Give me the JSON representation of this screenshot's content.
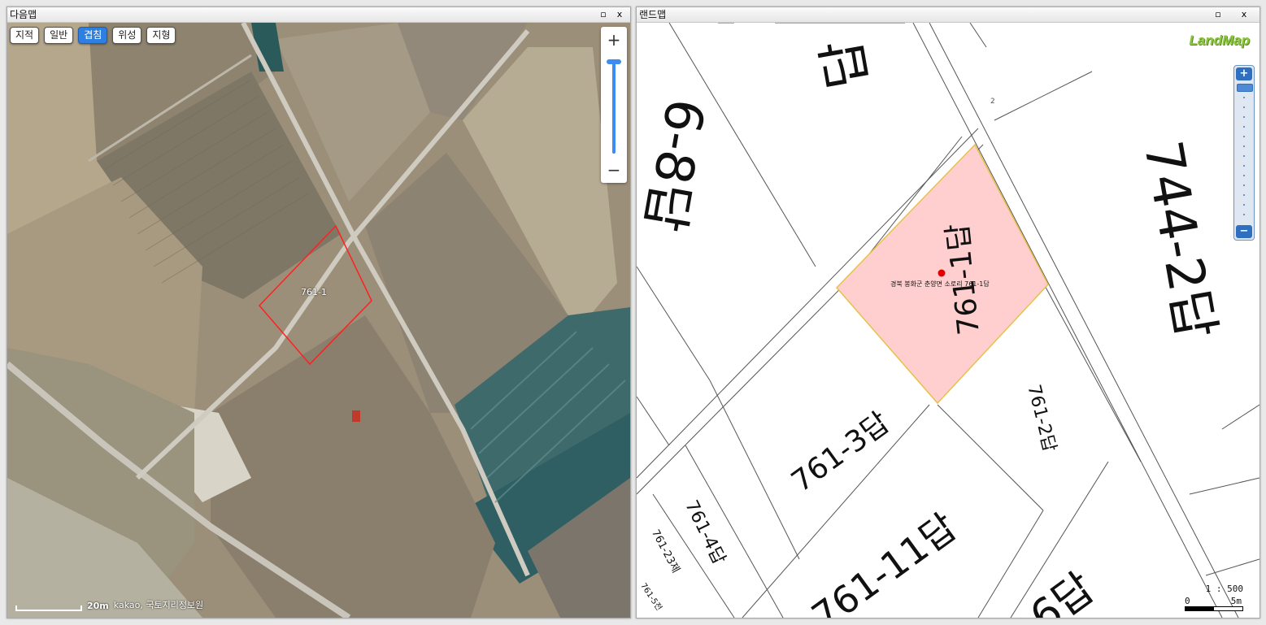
{
  "left_window": {
    "title": "다음맵",
    "minimize_label": "▫",
    "close_label": "x",
    "tabs": [
      {
        "label": "지적",
        "active": false
      },
      {
        "label": "일반",
        "active": false
      },
      {
        "label": "겹침",
        "active": true
      },
      {
        "label": "위성",
        "active": false
      },
      {
        "label": "지형",
        "active": false
      }
    ],
    "zoom_in_label": "+",
    "zoom_out_label": "−",
    "parcel_label": "761-1",
    "scale_text": "20m",
    "attribution": "kakao, 국토지리정보원"
  },
  "right_window": {
    "title": "랜드맵",
    "minimize_label": "▫",
    "close_label": "x",
    "logo": "LandMap",
    "zoom_in_label": "+",
    "zoom_out_label": "−",
    "selected_parcel_address": "경북 봉화군 춘양면 소로리 761-1답",
    "parcel_labels": {
      "p1": "답",
      "p2": "6-8답",
      "p3": "744-2답",
      "p4": "761-1답",
      "p5": "761-3답",
      "p6": "761-2답",
      "p7": "761-4답",
      "p8": "761-11답",
      "p9": "761-23제",
      "p10": "761-5전",
      "p11": "6답",
      "p12": "2"
    },
    "scale_ratio": "1 : 500",
    "scale_zero": "0",
    "scale_five": "5m"
  },
  "colors": {
    "selected_parcel_fill": "#ffcfcf",
    "selected_parcel_stroke": "#e8c04a",
    "active_tab": "#2f7fe0",
    "highlight_outline": "#ff2020",
    "logo_green": "#8cc63f"
  }
}
